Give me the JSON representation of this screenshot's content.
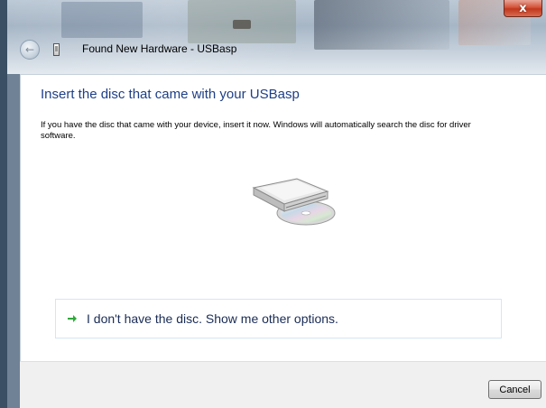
{
  "window": {
    "title": "Found New Hardware - USBasp",
    "close_label": "x"
  },
  "main": {
    "heading": "Insert the disc that came with your USBasp",
    "description": "If you have the disc that came with your device, insert it now.  Windows will automatically search the disc for driver software.",
    "option_label": "I don't have the disc.  Show me other options."
  },
  "footer": {
    "cancel_label": "Cancel"
  },
  "icons": {
    "back": "back-arrow-icon",
    "device": "usb-device-icon",
    "disc_drive": "disc-drive-icon",
    "option_arrow": "green-arrow-icon"
  },
  "colors": {
    "heading": "#1e3f87",
    "close_button": "#c0381e",
    "option_arrow": "#2fa83a"
  }
}
